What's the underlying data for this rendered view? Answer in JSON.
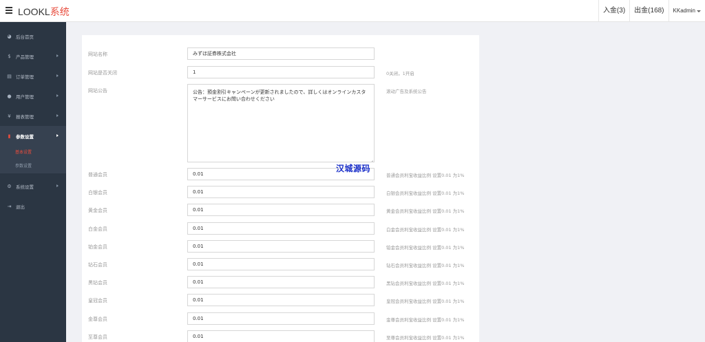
{
  "header": {
    "logo_main": "LOOKL",
    "logo_accent": "系统",
    "deposit": "入金(3)",
    "withdraw": "出金(168)",
    "user": "KKadmin"
  },
  "sidebar": {
    "items": [
      {
        "label": "后台首页",
        "icon": "dashboard-icon"
      },
      {
        "label": "产品管理",
        "icon": "yen-icon"
      },
      {
        "label": "订单管理",
        "icon": "order-icon"
      },
      {
        "label": "用户管理",
        "icon": "user-icon"
      },
      {
        "label": "报表管理",
        "icon": "yen-icon"
      },
      {
        "label": "参数设置",
        "icon": "file-icon"
      },
      {
        "label": "系统设置",
        "icon": "cogs-icon"
      },
      {
        "label": "退出",
        "icon": "logout-icon"
      }
    ],
    "sub_items": [
      {
        "label": "基本设置"
      },
      {
        "label": "参数设置"
      }
    ]
  },
  "form": {
    "site_name": {
      "label": "网站名称",
      "value": "みずほ証券株式会社"
    },
    "site_closed": {
      "label": "网站是否关闭",
      "value": "1",
      "hint": "0关闭，1开启"
    },
    "notice": {
      "label": "网站公告",
      "value": "公告：預金割引キャンペーンが更新されましたので、詳しくはオンラインカスタマーサービスにお問い合わせください",
      "hint": "滚动广告及系统公告"
    },
    "members": [
      {
        "label": "普通会员",
        "value": "0.01",
        "hint": "普通会员利宝收益比例 设置0.01 为1%"
      },
      {
        "label": "白银会员",
        "value": "0.01",
        "hint": "白银会员利宝收益比例 设置0.01 为1%"
      },
      {
        "label": "黄金会员",
        "value": "0.01",
        "hint": "黄金会员利宝收益比例 设置0.01 为1%"
      },
      {
        "label": "白金会员",
        "value": "0.01",
        "hint": "白金会员利宝收益比例 设置0.01 为1%"
      },
      {
        "label": "铂金会员",
        "value": "0.01",
        "hint": "铂金会员利宝收益比例 设置0.01 为1%"
      },
      {
        "label": "钻石会员",
        "value": "0.01",
        "hint": "钻石会员利宝收益比例 设置0.01 为1%"
      },
      {
        "label": "黑钻会员",
        "value": "0.01",
        "hint": "黑钻会员利宝收益比例 设置0.01 为1%"
      },
      {
        "label": "皇冠会员",
        "value": "0.01",
        "hint": "皇冠会员利宝收益比例 设置0.01 为1%"
      },
      {
        "label": "金尊会员",
        "value": "0.01",
        "hint": "金尊会员利宝收益比例 设置0.01 为1%"
      },
      {
        "label": "至尊会员",
        "value": "0.01",
        "hint": "至尊会员利宝收益比例 设置0.01 为1%"
      }
    ]
  },
  "watermark": "汉城源码",
  "colors": {
    "accent": "#e84c3d",
    "sidebar_bg": "#2b3643",
    "watermark": "#1a2fc9"
  }
}
